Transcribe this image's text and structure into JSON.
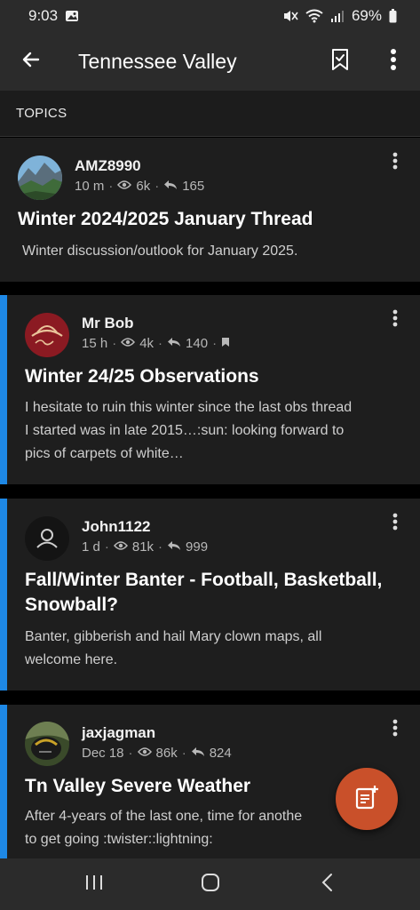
{
  "status_bar": {
    "time": "9:03",
    "battery": "69%",
    "icons": [
      "photo-icon",
      "mute-icon",
      "wifi-icon",
      "signal-icon",
      "battery-icon"
    ]
  },
  "app_bar": {
    "title": "Tennessee Valley",
    "icons": [
      "back-arrow-icon",
      "bookmark-icon",
      "more-vert-icon"
    ]
  },
  "section": {
    "header": "TOPICS"
  },
  "topics": [
    {
      "username": "AMZ8990",
      "time": "10 m",
      "views": "6k",
      "replies": "165",
      "title": "Winter 2024/2025 January Thread",
      "excerpt": "Winter discussion/outlook for January 2025.",
      "unread": false,
      "bookmarked": false
    },
    {
      "username": "Mr Bob",
      "time": "15 h",
      "views": "4k",
      "replies": "140",
      "title": "Winter 24/25 Observations",
      "excerpt_lines": [
        "I hesitate to ruin this winter since the last obs thread",
        "I started was in late 2015…:sun: looking forward to",
        "pics of carpets of white…"
      ],
      "unread": true,
      "bookmarked": true
    },
    {
      "username": "John1122",
      "time": "1 d",
      "views": "81k",
      "replies": "999",
      "title_lines": [
        "Fall/Winter Banter - Football, Basketball,",
        "Snowball?"
      ],
      "excerpt_lines": [
        "Banter, gibberish and hail Mary clown maps, all",
        "welcome here."
      ],
      "unread": true,
      "bookmarked": false
    },
    {
      "username": "jaxjagman",
      "time": "Dec 18",
      "views": "86k",
      "replies": "824",
      "title": "Tn Valley Severe Weather",
      "excerpt_lines": [
        "After 4-years of the last one, time for anothe",
        "to get going :twister::lightning:"
      ],
      "unread": true,
      "bookmarked": false
    }
  ],
  "colors": {
    "accent_unread": "#1e88e5",
    "fab": "#c9502a",
    "card_bg": "#1e1e1e",
    "bar_bg": "#2b2b2b"
  },
  "nav_bar": {
    "icons": [
      "recents-icon",
      "home-icon",
      "back-icon"
    ]
  }
}
